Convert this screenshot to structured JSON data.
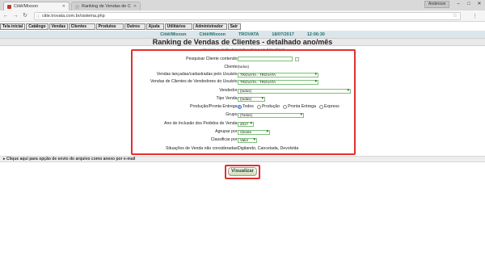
{
  "browser": {
    "tabs": [
      {
        "label": "Citiê/Mixxon",
        "active": true
      },
      {
        "label": "Ranking de Vendas de C",
        "active": false
      }
    ],
    "user": "Anderson",
    "url": "citie.trovata.com.br/sistema.php"
  },
  "app_menu": [
    "Tela inicial",
    "Catálogo",
    "Vendas",
    "Clientes",
    "Produtos",
    "Outros",
    "Ajuda",
    "Utilitários",
    "Administrador",
    "Sair"
  ],
  "info_bar": {
    "company1": "Citiê/Mixxon",
    "company2": "Citiê/Mixxon",
    "brand": "TROVATA",
    "date": "18/07/2017",
    "time": "12:06:30"
  },
  "page_title": "Ranking de Vendas de Clientes - detalhado ano/mês",
  "hint": "...selecione a opção desejada e clique em [Visualizar]...",
  "form": {
    "search_label": "Pesquisar Cliente contendo:",
    "search_value": "",
    "cliente_label": "Cliente:",
    "cliente_value": "(todos)",
    "vendas_lancadas_label": "Vendas lançadas/cadastradas pelo Usuário:",
    "vendas_lancadas_value": "TROVATA - TROVATA",
    "vendas_clientes_label": "Vendas de Clientes de Vendedores do Usuário:",
    "vendas_clientes_value": "TROVATA - TROVATA",
    "vendedor_label": "Vendedor:",
    "vendedor_value": "(todos)",
    "tipo_venda_label": "Tipo Venda:",
    "tipo_venda_value": "(todas)",
    "producao_label": "Produção/Pronta Entrega:",
    "producao_options": [
      "Todos",
      "Produção",
      "Pronta Entrega",
      "Express"
    ],
    "producao_selected": "Todos",
    "grupo_label": "Grupo:",
    "grupo_value": "(Todos)",
    "ano_label": "Ano de Inclusão dos Pedidos de Venda:",
    "ano_value": "2017",
    "agrupar_label": "Agrupar por:",
    "agrupar_value": "Cliente",
    "classificar_label": "Classificar por:",
    "classificar_value": "Valor",
    "situacoes_label": "Situações de Venda não consideradas:",
    "situacoes_value": "Digitando, Cancelada, Devolvida"
  },
  "email_bar": "Clique aqui para opção de envio do arquivo como anexo por e-mail",
  "visualizar_label": "Visualizar",
  "colors": {
    "highlight": "#e0312f",
    "info_text": "#1f6f6f",
    "input_border": "#7fbf7f"
  }
}
